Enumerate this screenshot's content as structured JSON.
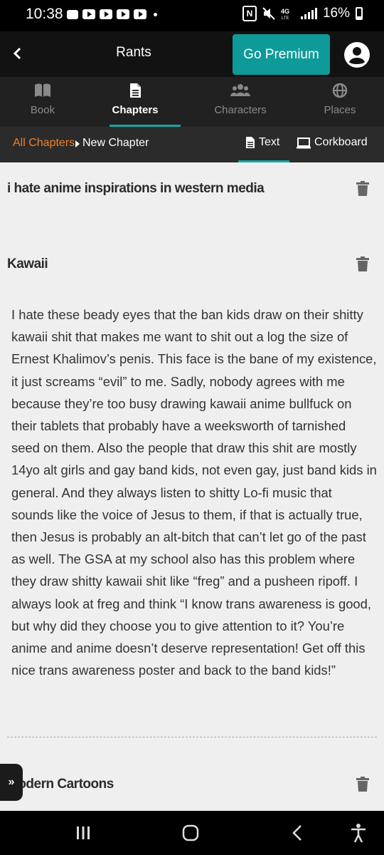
{
  "status_bar": {
    "time": "10:38",
    "battery": "16%"
  },
  "app_bar": {
    "title": "Rants",
    "premium_label": "Go Premium"
  },
  "tabs": [
    {
      "label": "Book",
      "icon": "book-icon"
    },
    {
      "label": "Chapters",
      "icon": "document-icon",
      "active": true
    },
    {
      "label": "Characters",
      "icon": "group-icon"
    },
    {
      "label": "Places",
      "icon": "globe-icon"
    }
  ],
  "breadcrumb": {
    "all": "All Chapters",
    "current": "New Chapter"
  },
  "view_toggle": {
    "text": "Text",
    "corkboard": "Corkboard"
  },
  "sections": [
    {
      "title": "i hate anime inspirations in western media"
    },
    {
      "title": "Kawaii",
      "body": "I hate these beady eyes that the ban kids draw on their shitty kawaii shit that makes me want to shit out a log the size of Ernest Khalimov’s penis. This face is the bane of my existence, it just screams “evil” to me. Sadly, nobody agrees with me because they’re too busy drawing kawaii anime bullfuck on their tablets that probably have a weeksworth of tarnished seed on them. Also the people that draw this shit are mostly 14yo alt girls and gay band kids, not even gay, just band kids in general. And they always listen to shitty Lo-fi music that sounds like the voice of Jesus to them, if that is actually true, then Jesus is probably an alt-bitch that can’t let go of the past as well. The GSA at my school also has this problem where they draw shitty kawaii shit like “freg” and a pusheen ripoff. I always look at freg and think “I know trans awareness is good, but why did they choose you to give attention to it? You’re anime and anime doesn’t deserve representation! Get off this nice trans awareness poster and back to the band kids!”"
    },
    {
      "title": "Modern Cartoons"
    }
  ],
  "float_button": {
    "label": "»"
  },
  "colors": {
    "accent": "#0f9a9a",
    "breadcrumb": "#f07f2a"
  }
}
